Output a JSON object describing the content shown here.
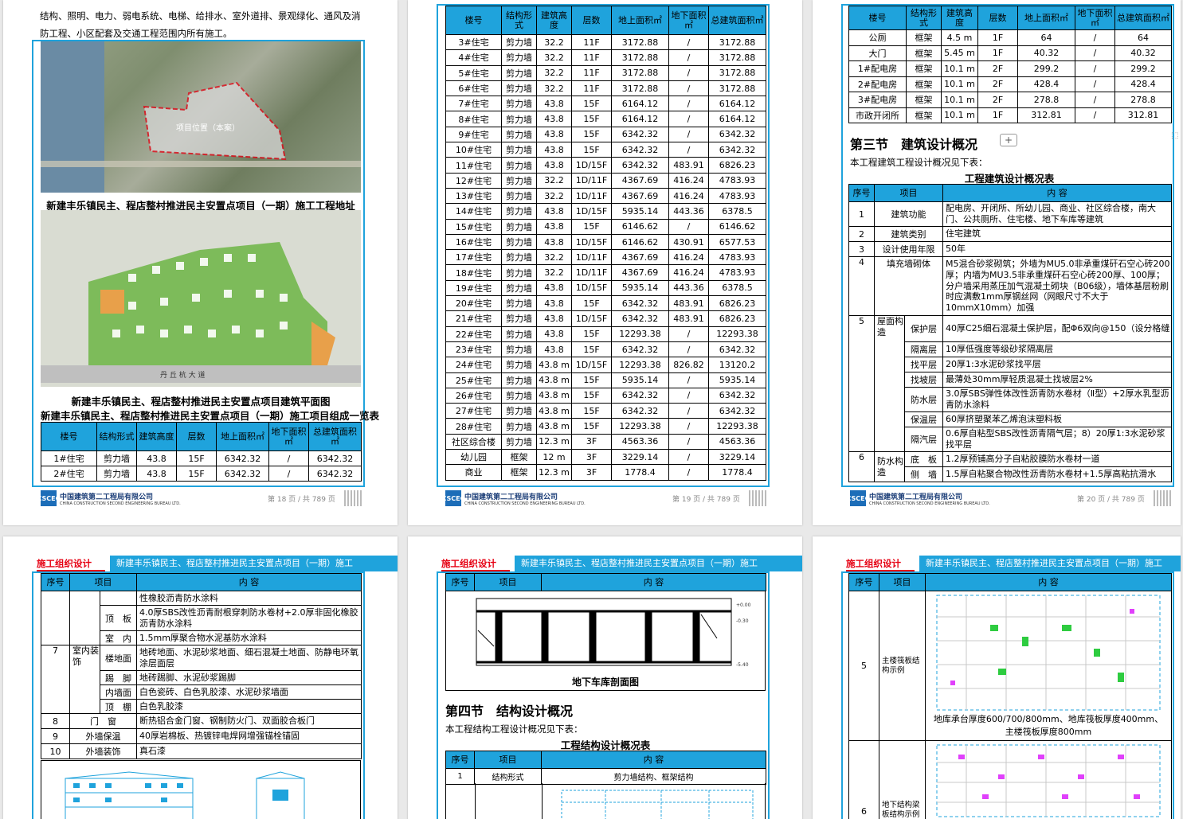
{
  "p18": {
    "text_line1": "结构、照明、电力、弱电系统、电梯、给排水、室外道排、景观绿化、通风及消",
    "text_line2": "防工程、小区配套及交通工程范围内所有施工。",
    "map_label": "项目位置（本案）",
    "cap1": "新建丰乐镇民主、程店整村推进民主安置点项目（一期）施工工程地址",
    "road_label": "丹 丘 杭 大 道",
    "cap2": "新建丰乐镇民主、程店整村推进民主安置点项目建筑平面图",
    "cap3": "新建丰乐镇民主、程店整村推进民主安置点项目（一期）施工项目组成一览表",
    "headers": [
      "楼号",
      "结构形式",
      "建筑高度",
      "层数",
      "地上面积㎡",
      "地下面积㎡",
      "总建筑面积㎡"
    ],
    "rows": [
      [
        "1#住宅",
        "剪力墙",
        "43.8",
        "15F",
        "6342.32",
        "/",
        "6342.32"
      ],
      [
        "2#住宅",
        "剪力墙",
        "43.8",
        "15F",
        "6342.32",
        "/",
        "6342.32"
      ]
    ],
    "page_no": "第 18 页 / 共 789 页"
  },
  "p19": {
    "headers": [
      "楼号",
      "结构形式",
      "建筑高度",
      "层数",
      "地上面积㎡",
      "地下面积㎡",
      "总建筑面积㎡"
    ],
    "rows": [
      [
        "3#住宅",
        "剪力墙",
        "32.2",
        "11F",
        "3172.88",
        "/",
        "3172.88"
      ],
      [
        "4#住宅",
        "剪力墙",
        "32.2",
        "11F",
        "3172.88",
        "/",
        "3172.88"
      ],
      [
        "5#住宅",
        "剪力墙",
        "32.2",
        "11F",
        "3172.88",
        "/",
        "3172.88"
      ],
      [
        "6#住宅",
        "剪力墙",
        "32.2",
        "11F",
        "3172.88",
        "/",
        "3172.88"
      ],
      [
        "7#住宅",
        "剪力墙",
        "43.8",
        "15F",
        "6164.12",
        "/",
        "6164.12"
      ],
      [
        "8#住宅",
        "剪力墙",
        "43.8",
        "15F",
        "6164.12",
        "/",
        "6164.12"
      ],
      [
        "9#住宅",
        "剪力墙",
        "43.8",
        "15F",
        "6342.32",
        "/",
        "6342.32"
      ],
      [
        "10#住宅",
        "剪力墙",
        "43.8",
        "15F",
        "6342.32",
        "/",
        "6342.32"
      ],
      [
        "11#住宅",
        "剪力墙",
        "43.8",
        "1D/15F",
        "6342.32",
        "483.91",
        "6826.23"
      ],
      [
        "12#住宅",
        "剪力墙",
        "32.2",
        "1D/11F",
        "4367.69",
        "416.24",
        "4783.93"
      ],
      [
        "13#住宅",
        "剪力墙",
        "32.2",
        "1D/11F",
        "4367.69",
        "416.24",
        "4783.93"
      ],
      [
        "14#住宅",
        "剪力墙",
        "43.8",
        "1D/15F",
        "5935.14",
        "443.36",
        "6378.5"
      ],
      [
        "15#住宅",
        "剪力墙",
        "43.8",
        "15F",
        "6146.62",
        "/",
        "6146.62"
      ],
      [
        "16#住宅",
        "剪力墙",
        "43.8",
        "1D/15F",
        "6146.62",
        "430.91",
        "6577.53"
      ],
      [
        "17#住宅",
        "剪力墙",
        "32.2",
        "1D/11F",
        "4367.69",
        "416.24",
        "4783.93"
      ],
      [
        "18#住宅",
        "剪力墙",
        "32.2",
        "1D/11F",
        "4367.69",
        "416.24",
        "4783.93"
      ],
      [
        "19#住宅",
        "剪力墙",
        "43.8",
        "1D/15F",
        "5935.14",
        "443.36",
        "6378.5"
      ],
      [
        "20#住宅",
        "剪力墙",
        "43.8",
        "15F",
        "6342.32",
        "483.91",
        "6826.23"
      ],
      [
        "21#住宅",
        "剪力墙",
        "43.8",
        "1D/15F",
        "6342.32",
        "483.91",
        "6826.23"
      ],
      [
        "22#住宅",
        "剪力墙",
        "43.8",
        "15F",
        "12293.38",
        "/",
        "12293.38"
      ],
      [
        "23#住宅",
        "剪力墙",
        "43.8",
        "15F",
        "6342.32",
        "/",
        "6342.32"
      ],
      [
        "24#住宅",
        "剪力墙",
        "43.8 m",
        "1D/15F",
        "12293.38",
        "826.82",
        "13120.2"
      ],
      [
        "25#住宅",
        "剪力墙",
        "43.8 m",
        "15F",
        "5935.14",
        "/",
        "5935.14"
      ],
      [
        "26#住宅",
        "剪力墙",
        "43.8 m",
        "15F",
        "6342.32",
        "/",
        "6342.32"
      ],
      [
        "27#住宅",
        "剪力墙",
        "43.8 m",
        "15F",
        "6342.32",
        "/",
        "6342.32"
      ],
      [
        "28#住宅",
        "剪力墙",
        "43.8 m",
        "15F",
        "12293.38",
        "/",
        "12293.38"
      ],
      [
        "社区综合楼",
        "剪力墙",
        "12.3 m",
        "3F",
        "4563.36",
        "/",
        "4563.36"
      ],
      [
        "幼儿园",
        "框架",
        "12 m",
        "3F",
        "3229.14",
        "/",
        "3229.14"
      ],
      [
        "商业",
        "框架",
        "12.3 m",
        "3F",
        "1778.4",
        "/",
        "1778.4"
      ]
    ],
    "page_no": "第 19 页 / 共 789 页"
  },
  "p20": {
    "headers": [
      "楼号",
      "结构形式",
      "建筑高度",
      "层数",
      "地上面积㎡",
      "地下面积㎡",
      "总建筑面积㎡"
    ],
    "rows": [
      [
        "公厕",
        "框架",
        "4.5 m",
        "1F",
        "64",
        "/",
        "64"
      ],
      [
        "大门",
        "框架",
        "5.45 m",
        "1F",
        "40.32",
        "/",
        "40.32"
      ],
      [
        "1#配电房",
        "框架",
        "10.1 m",
        "2F",
        "299.2",
        "/",
        "299.2"
      ],
      [
        "2#配电房",
        "框架",
        "10.1 m",
        "2F",
        "428.4",
        "/",
        "428.4"
      ],
      [
        "3#配电房",
        "框架",
        "10.1 m",
        "2F",
        "278.8",
        "/",
        "278.8"
      ],
      [
        "市政开闭所",
        "框架",
        "10.1 m",
        "1F",
        "312.81",
        "/",
        "312.81"
      ]
    ],
    "section_title": "第三节　建筑设计概况",
    "plus": "+",
    "intro": "本工程建筑工程设计概况见下表：",
    "table_title": "工程建筑设计概况表",
    "d_headers": [
      "序号",
      "项目",
      "内 容"
    ],
    "d1_content": "配电房、开闭所、所幼儿园、商业、社区综合楼，南大门、公共厕所、住宅楼、地下车库等建筑",
    "d2_content": "住宅建筑",
    "d3_content": "50年",
    "d4_content": "M5混合砂浆砌筑；外墙为MU5.0非承重煤矸石空心砖200厚；内墙为MU3.5非承重煤矸石空心砖200厚、100厚；分户墙采用蒸压加气混凝土砌块（B06级），墙体基层粉刷时应满敷1mm厚钢丝网（网眼尺寸不大于10mmX10mm）加强",
    "d5_sub": [
      [
        "保护层",
        "40厚C25细石混凝土保护层，配Φ6双向@150（设分格缝"
      ],
      [
        "隔离层",
        "10厚低强度等级砂浆隔离层"
      ],
      [
        "找平层",
        "20厚1:3水泥砂浆找平层"
      ],
      [
        "找坡层",
        "最薄处30mm厚轻质混凝土找坡层2%"
      ],
      [
        "防水层",
        "3.0厚SBS弹性体改性沥青防水卷材（Ⅱ型）+2厚水乳型沥青防水涂料"
      ],
      [
        "保温层",
        "60厚挤塑聚苯乙烯泡沫塑料板"
      ],
      [
        "隔汽层",
        "0.6厚自粘型SBS改性沥青隔气层；8）20厚1:3水泥砂浆找平层"
      ]
    ],
    "d6_sub": [
      [
        "底　板",
        "1.2厚预铺高分子自粘胶膜防水卷材一道"
      ],
      [
        "侧　墙",
        "1.5厚自粘聚合物改性沥青防水卷材+1.5厚高粘抗滑水"
      ]
    ],
    "rows_d": [
      [
        "1",
        "建筑功能"
      ],
      [
        "2",
        "建筑类别"
      ],
      [
        "3",
        "设计使用年限"
      ],
      [
        "4",
        "填充墙砌体"
      ],
      [
        "5",
        "屋面构造"
      ],
      [
        "6",
        "防水构造"
      ]
    ],
    "page_no": "第 20 页 / 共 789 页"
  },
  "p21": {
    "hdr_red": "施工组织设计",
    "hdr_blue": "新建丰乐镇民主、程店整村推进民主安置点项目（一期）施工",
    "d_headers": [
      "序号",
      "项目",
      "内 容"
    ],
    "r0": "性橡胶沥青防水涂料",
    "r1": [
      "顶　板",
      "4.0厚SBS改性沥青耐根穿刺防水卷材+2.0厚非固化橡胶沥青防水涂料"
    ],
    "r2": [
      "室　内",
      "1.5mm厚聚合物水泥基防水涂料"
    ],
    "r7_no": "7",
    "r7_item": "室内装饰",
    "r7_sub": [
      [
        "楼地面",
        "地砖地面、水泥砂浆地面、细石混凝土地面、防静电环氧涂层面层"
      ],
      [
        "踢　脚",
        "地砖踢脚、水泥砂浆踢脚"
      ],
      [
        "内墙面",
        "白色瓷砖、白色乳胶漆、水泥砂浆墙面"
      ],
      [
        "顶　棚",
        "白色乳胶漆"
      ]
    ],
    "r8": [
      "8",
      "门　窗",
      "断热铝合金门窗、钢制防火门、双面胶合板门"
    ],
    "r9": [
      "9",
      "外墙保温",
      "40厚岩棉板、热镀锌电焊网增强锚栓锚固"
    ],
    "r10": [
      "10",
      "外墙装饰",
      "真石漆"
    ]
  },
  "p22": {
    "hdr_red": "施工组织设计",
    "hdr_blue": "新建丰乐镇民主、程店整村推进民主安置点项目（一期）施工",
    "d_headers": [
      "序号",
      "项目",
      "内 容"
    ],
    "drawing_caption": "地下车库剖面图",
    "section_title": "第四节　结构设计概况",
    "intro": "本工程结构工程设计概况见下表：",
    "table_title": "工程结构设计概况表",
    "r1": [
      "1",
      "结构形式",
      "剪力墙结构、框架结构"
    ]
  },
  "p23": {
    "hdr_red": "施工组织设计",
    "hdr_blue": "新建丰乐镇民主、程店整村推进民主安置点项目（一期）施工",
    "d_headers": [
      "序号",
      "项目",
      "内 容"
    ],
    "r5": [
      "5",
      "主楼筏板结构示例"
    ],
    "r5_cap1": "地库承台厚度600/700/800mm、地库筏板厚度400mm、",
    "r5_cap2": "主楼筏板厚度800mm",
    "r6": [
      "6",
      "地下结构梁板结构示例"
    ]
  },
  "footer": {
    "company_cn": "中国建筑第二工程局有限公司",
    "company_en": "CHINA CONSTRUCTION SECOND ENGINEERING BUREAU LTD.",
    "logo": "CSCEC"
  }
}
